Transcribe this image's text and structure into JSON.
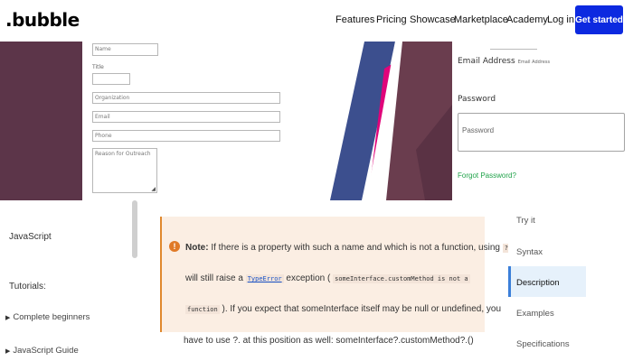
{
  "nav": {
    "logo": ".bubble",
    "links": [
      "Features",
      "Pricing",
      "Showcase",
      "Marketplace",
      "Academy",
      "Log in"
    ],
    "cta": "Get started"
  },
  "form": {
    "name_ph": "Name",
    "title_label": "Title",
    "organization_ph": "Organization",
    "email_ph": "Email",
    "phone_ph": "Phone",
    "reason_ph": "Reason for Outreach"
  },
  "login": {
    "email_label": "Email Address",
    "email_ph": "Email Address",
    "password_label": "Password",
    "password_ph": "Password",
    "forgot": "Forgot Password?"
  },
  "sidebar": {
    "section": "JavaScript",
    "tutorials_label": "Tutorials:",
    "items": [
      "Complete beginners",
      "JavaScript Guide"
    ]
  },
  "note": {
    "label": "Note:",
    "l1": "If there is a property with such a name and which is not a function, using",
    "l1_code": "?.",
    "l2_a": "will still raise a",
    "l2_link": "TypeError",
    "l2_b": "exception (",
    "l2_code": "someInterface.customMethod is not a",
    "l3_code": "function",
    "l3_b": "). If you expect that someInterface itself may be null or undefined, you",
    "below": "have to use ?. at this position as well: someInterface?.customMethod?.()"
  },
  "toc": {
    "items": [
      "Try it",
      "Syntax",
      "Description",
      "Examples",
      "Specifications"
    ],
    "active": "Description"
  },
  "colors": {
    "brand_blue": "#0c29e0",
    "maroon": "#5c3549",
    "forgot_green": "#20a34a",
    "note_bg": "#fbeee3",
    "note_accent": "#e0892e",
    "toc_active": "#3b7fd9"
  }
}
